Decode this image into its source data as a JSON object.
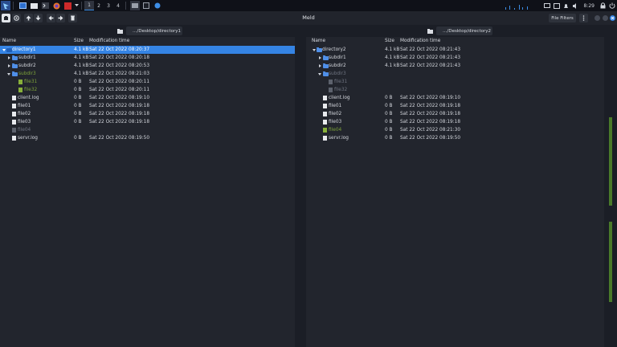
{
  "panel": {
    "workspaces": [
      "1",
      "2",
      "3",
      "4"
    ],
    "clock": "8:29"
  },
  "window": {
    "title": "Meld",
    "file_filters_label": "File Filters"
  },
  "left": {
    "path": "…/Desktop/directory1",
    "columns": {
      "name": "Name",
      "size": "Size",
      "mtime": "Modification time"
    },
    "rows": [
      {
        "name": "directory1",
        "size": "4.1 kB",
        "mtime": "Sat 22 Oct 2022 08:20:37"
      },
      {
        "name": "subdir1",
        "size": "4.1 kB",
        "mtime": "Sat 22 Oct 2022 08:20:18"
      },
      {
        "name": "subdir2",
        "size": "4.1 kB",
        "mtime": "Sat 22 Oct 2022 08:20:53"
      },
      {
        "name": "subdir3",
        "size": "4.1 kB",
        "mtime": "Sat 22 Oct 2022 08:21:03"
      },
      {
        "name": "file31",
        "size": "0 B",
        "mtime": "Sat 22 Oct 2022 08:20:11"
      },
      {
        "name": "file32",
        "size": "0 B",
        "mtime": "Sat 22 Oct 2022 08:20:11"
      },
      {
        "name": "client.log",
        "size": "0 B",
        "mtime": "Sat 22 Oct 2022 08:19:10"
      },
      {
        "name": "file01",
        "size": "0 B",
        "mtime": "Sat 22 Oct 2022 08:19:18"
      },
      {
        "name": "file02",
        "size": "0 B",
        "mtime": "Sat 22 Oct 2022 08:19:18"
      },
      {
        "name": "file03",
        "size": "0 B",
        "mtime": "Sat 22 Oct 2022 08:19:18"
      },
      {
        "name": "file04",
        "size": "",
        "mtime": ""
      },
      {
        "name": "servr.log",
        "size": "0 B",
        "mtime": "Sat 22 Oct 2022 08:19:50"
      }
    ]
  },
  "right": {
    "path": "…/Desktop/directory2",
    "columns": {
      "name": "Name",
      "size": "Size",
      "mtime": "Modification time"
    },
    "rows": [
      {
        "name": "directory2",
        "size": "4.1 kB",
        "mtime": "Sat 22 Oct 2022 08:21:43"
      },
      {
        "name": "subdir1",
        "size": "4.1 kB",
        "mtime": "Sat 22 Oct 2022 08:21:43"
      },
      {
        "name": "subdir2",
        "size": "4.1 kB",
        "mtime": "Sat 22 Oct 2022 08:21:43"
      },
      {
        "name": "subdir3",
        "size": "",
        "mtime": ""
      },
      {
        "name": "file31",
        "size": "",
        "mtime": ""
      },
      {
        "name": "file32",
        "size": "",
        "mtime": ""
      },
      {
        "name": "client.log",
        "size": "0 B",
        "mtime": "Sat 22 Oct 2022 08:19:10"
      },
      {
        "name": "file01",
        "size": "0 B",
        "mtime": "Sat 22 Oct 2022 08:19:18"
      },
      {
        "name": "file02",
        "size": "0 B",
        "mtime": "Sat 22 Oct 2022 08:19:18"
      },
      {
        "name": "file03",
        "size": "0 B",
        "mtime": "Sat 22 Oct 2022 08:19:18"
      },
      {
        "name": "file04",
        "size": "0 B",
        "mtime": "Sat 22 Oct 2022 08:21:30"
      },
      {
        "name": "servr.log",
        "size": "0 B",
        "mtime": "Sat 22 Oct 2022 08:19:50"
      }
    ]
  },
  "colors": {
    "selection": "#3584e4",
    "new_item": "#7da33a",
    "missing_item": "#6f7480",
    "folder": "#4f8fe8"
  }
}
